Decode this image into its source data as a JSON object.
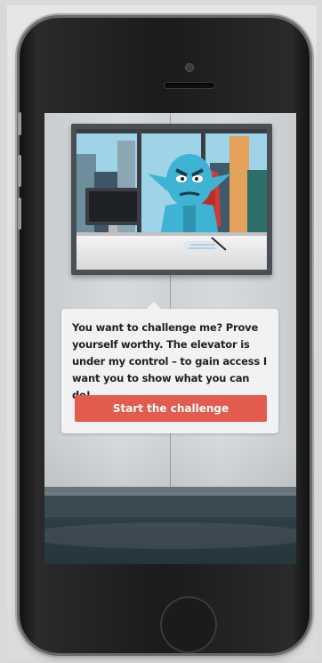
{
  "dialog": {
    "message": "You want to challenge me? Prove yourself worthy. The elevator is under my control – to gain access I want you to show what you can do!",
    "button_label": "Start the challenge"
  },
  "colors": {
    "button": "#e35b4f",
    "character": "#3fb3d3",
    "screen_bg": "#d1d5d7",
    "phone_body": "#1b1b1b"
  },
  "icons": {
    "character": "blue-goblin-boss",
    "monitor": "desktop-monitor-icon",
    "chair": "office-chair-icon"
  }
}
